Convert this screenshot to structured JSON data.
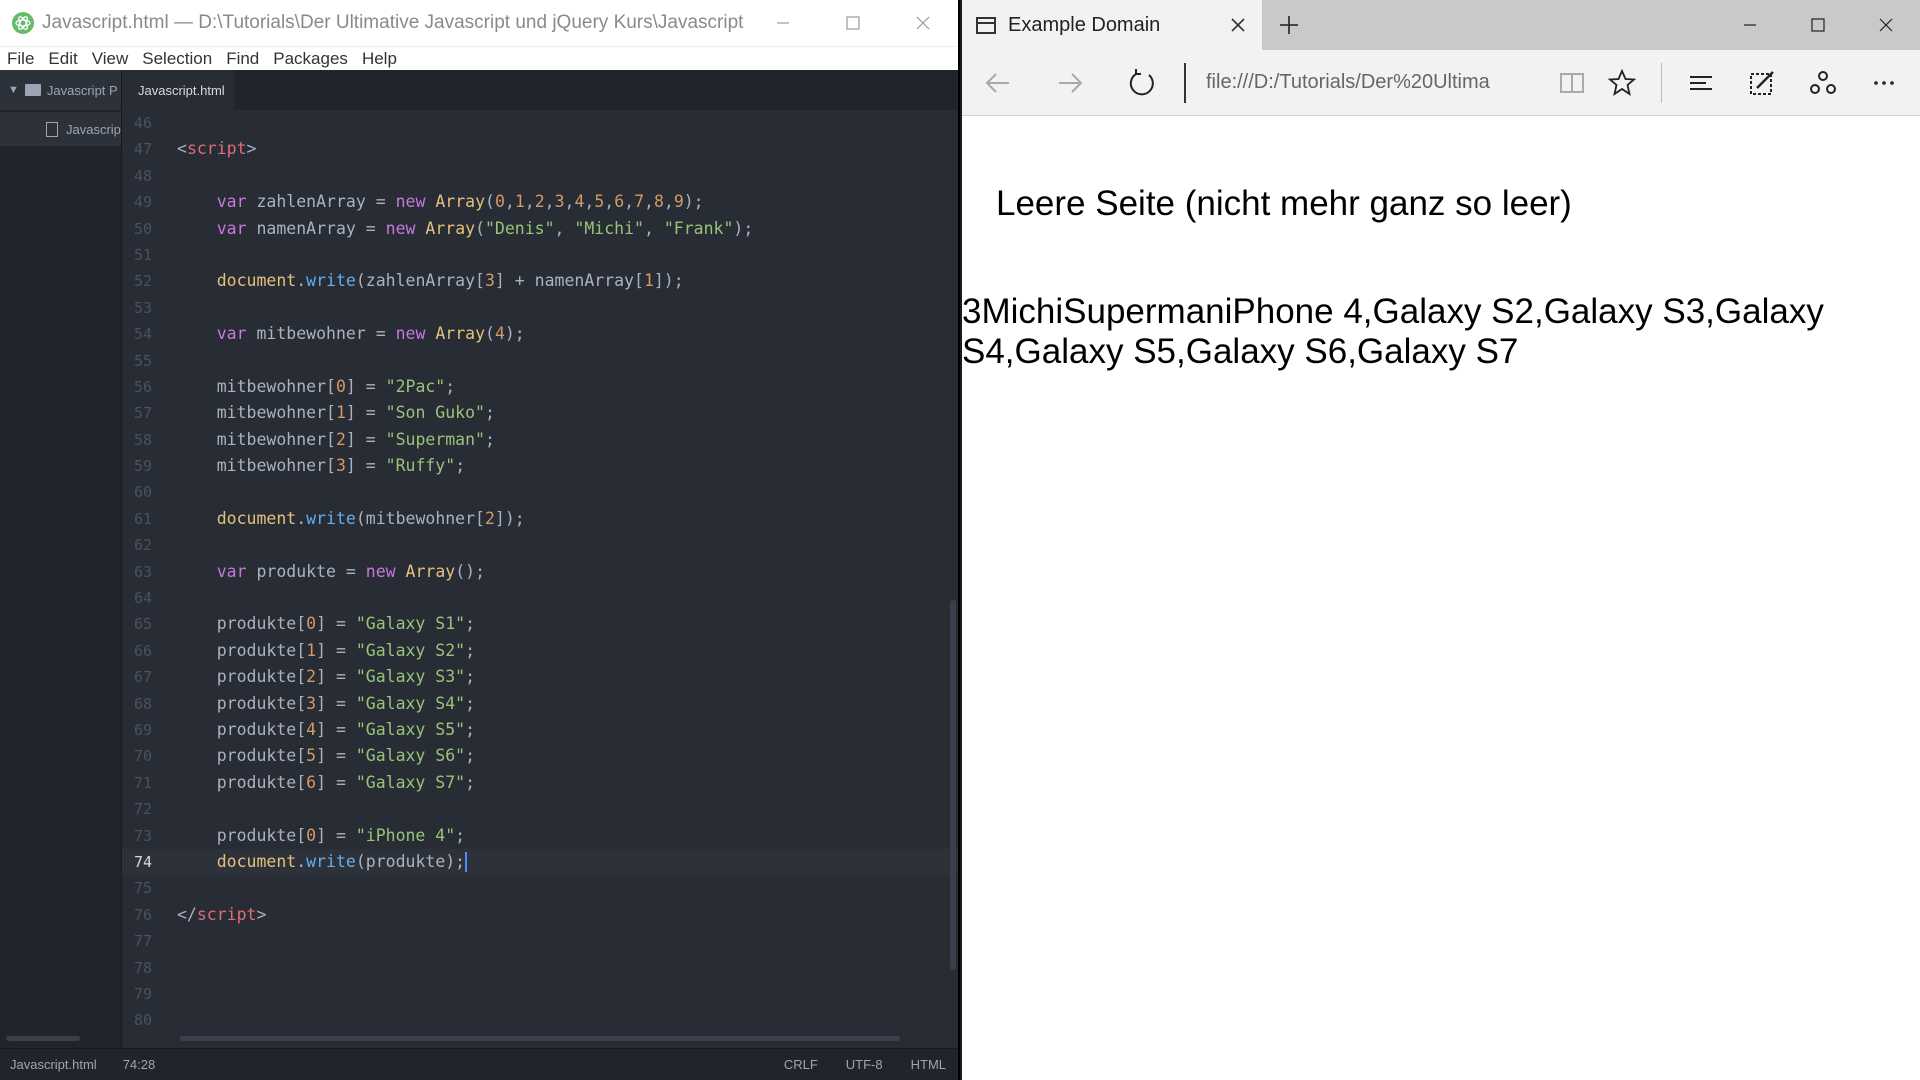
{
  "editor": {
    "window_title": "Javascript.html — D:\\Tutorials\\Der Ultimative Javascript und jQuery Kurs\\Javascript Proj...",
    "menu": [
      "File",
      "Edit",
      "View",
      "Selection",
      "Find",
      "Packages",
      "Help"
    ],
    "tree": {
      "root": "Javascript P",
      "file": "Javascrip"
    },
    "tab": "Javascript.html",
    "code_lines": [
      {
        "n": "46",
        "html": ""
      },
      {
        "n": "47",
        "html": "<span class='punc'>&lt;</span><span class='tag'>script</span><span class='punc'>&gt;</span>"
      },
      {
        "n": "48",
        "html": ""
      },
      {
        "n": "49",
        "html": "    <span class='kw'>var</span> zahlenArray = <span class='kw'>new</span> <span class='obj'>Array</span>(<span class='num'>0</span>,<span class='num'>1</span>,<span class='num'>2</span>,<span class='num'>3</span>,<span class='num'>4</span>,<span class='num'>5</span>,<span class='num'>6</span>,<span class='num'>7</span>,<span class='num'>8</span>,<span class='num'>9</span>);"
      },
      {
        "n": "50",
        "html": "    <span class='kw'>var</span> namenArray = <span class='kw'>new</span> <span class='obj'>Array</span>(<span class='str'>\"Denis\"</span>, <span class='str'>\"Michi\"</span>, <span class='str'>\"Frank\"</span>);"
      },
      {
        "n": "51",
        "html": ""
      },
      {
        "n": "52",
        "html": "    <span class='obj'>document</span>.<span class='fn'>write</span>(zahlenArray[<span class='num'>3</span>] + namenArray[<span class='num'>1</span>]);"
      },
      {
        "n": "53",
        "html": ""
      },
      {
        "n": "54",
        "html": "    <span class='kw'>var</span> mitbewohner = <span class='kw'>new</span> <span class='obj'>Array</span>(<span class='num'>4</span>);"
      },
      {
        "n": "55",
        "html": ""
      },
      {
        "n": "56",
        "html": "    mitbewohner[<span class='num'>0</span>] = <span class='str'>\"2Pac\"</span>;"
      },
      {
        "n": "57",
        "html": "    mitbewohner[<span class='num'>1</span>] = <span class='str'>\"Son Guko\"</span>;"
      },
      {
        "n": "58",
        "html": "    mitbewohner[<span class='num'>2</span>] = <span class='str'>\"Superman\"</span>;"
      },
      {
        "n": "59",
        "html": "    mitbewohner[<span class='num'>3</span>] = <span class='str'>\"Ruffy\"</span>;"
      },
      {
        "n": "60",
        "html": ""
      },
      {
        "n": "61",
        "html": "    <span class='obj'>document</span>.<span class='fn'>write</span>(mitbewohner[<span class='num'>2</span>]);"
      },
      {
        "n": "62",
        "html": ""
      },
      {
        "n": "63",
        "html": "    <span class='kw'>var</span> produkte = <span class='kw'>new</span> <span class='obj'>Array</span>();"
      },
      {
        "n": "64",
        "html": ""
      },
      {
        "n": "65",
        "html": "    produkte[<span class='num'>0</span>] = <span class='str'>\"Galaxy S1\"</span>;"
      },
      {
        "n": "66",
        "html": "    produkte[<span class='num'>1</span>] = <span class='str'>\"Galaxy S2\"</span>;"
      },
      {
        "n": "67",
        "html": "    produkte[<span class='num'>2</span>] = <span class='str'>\"Galaxy S3\"</span>;"
      },
      {
        "n": "68",
        "html": "    produkte[<span class='num'>3</span>] = <span class='str'>\"Galaxy S4\"</span>;"
      },
      {
        "n": "69",
        "html": "    produkte[<span class='num'>4</span>] = <span class='str'>\"Galaxy S5\"</span>;"
      },
      {
        "n": "70",
        "html": "    produkte[<span class='num'>5</span>] = <span class='str'>\"Galaxy S6\"</span>;"
      },
      {
        "n": "71",
        "html": "    produkte[<span class='num'>6</span>] = <span class='str'>\"Galaxy S7\"</span>;"
      },
      {
        "n": "72",
        "html": ""
      },
      {
        "n": "73",
        "html": "    produkte[<span class='num'>0</span>] = <span class='str'>\"iPhone 4\"</span>;"
      },
      {
        "n": "74",
        "html": "    <span class='obj'>document</span>.<span class='fn'>write</span>(produkte);<span class='cursor'></span>",
        "active": true
      },
      {
        "n": "75",
        "html": ""
      },
      {
        "n": "76",
        "html": "<span class='punc'>&lt;/</span><span class='tag'>script</span><span class='punc'>&gt;</span>"
      },
      {
        "n": "77",
        "html": ""
      },
      {
        "n": "78",
        "html": ""
      },
      {
        "n": "79",
        "html": ""
      },
      {
        "n": "80",
        "html": ""
      }
    ],
    "status": {
      "file": "Javascript.html",
      "position": "74:28",
      "line_ending": "CRLF",
      "encoding": "UTF-8",
      "grammar": "HTML"
    }
  },
  "browser": {
    "tab_title": "Example Domain",
    "address": "file:///D:/Tutorials/Der%20Ultima",
    "page_heading": "Leere Seite (nicht mehr ganz so leer)",
    "page_output": "3MichiSupermaniPhone 4,Galaxy S2,Galaxy S3,Galaxy S4,Galaxy S5,Galaxy S6,Galaxy S7"
  }
}
